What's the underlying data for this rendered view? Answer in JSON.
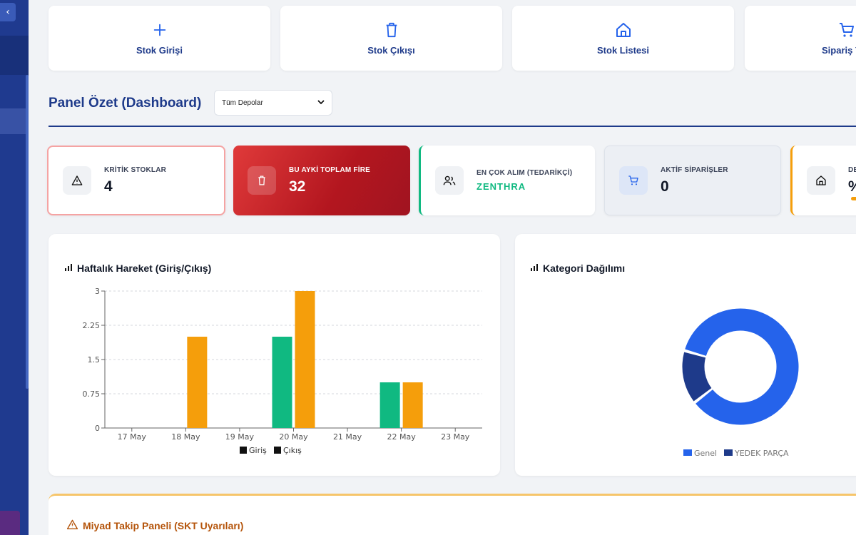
{
  "quick_actions": [
    {
      "label": "Stok Girişi",
      "icon": "plus-icon"
    },
    {
      "label": "Stok Çıkışı",
      "icon": "trash-icon"
    },
    {
      "label": "Stok Listesi",
      "icon": "home-icon"
    },
    {
      "label": "Sipariş Y",
      "icon": "cart-icon"
    }
  ],
  "header": {
    "title": "Panel Özet (Dashboard)",
    "depot_select": "Tüm Depolar"
  },
  "stats": {
    "critical": {
      "label": "KRİTİK STOKLAR",
      "value": "4"
    },
    "fire": {
      "label": "BU AYKİ TOPLAM FİRE",
      "value": "32"
    },
    "supplier": {
      "label": "EN ÇOK ALIM (TEDARİKÇİ)",
      "value": "ZENTHRA"
    },
    "orders": {
      "label": "AKTİF SİPARİŞLER",
      "value": "0"
    },
    "depot": {
      "label": "DE",
      "value": "%"
    }
  },
  "weekly_panel": {
    "title": "Haftalık Hareket (Giriş/Çıkış)"
  },
  "category_panel": {
    "title": "Kategori Dağılımı"
  },
  "bottom_panel": {
    "title": "Miyad Takip Paneli (SKT Uyarıları)"
  },
  "colors": {
    "primary": "#1e3a8a",
    "giris": "#10b981",
    "cikis": "#f59e0b",
    "genel": "#2563eb",
    "yedek": "#1e3a8a"
  },
  "chart_data": [
    {
      "type": "bar",
      "title": "Haftalık Hareket (Giriş/Çıkış)",
      "categories": [
        "17 May",
        "18 May",
        "19 May",
        "20 May",
        "21 May",
        "22 May",
        "23 May"
      ],
      "series": [
        {
          "name": "Giriş",
          "values": [
            0,
            0,
            0,
            2,
            0,
            1,
            0
          ]
        },
        {
          "name": "Çıkış",
          "values": [
            0,
            2,
            0,
            3,
            0,
            1,
            0
          ]
        }
      ],
      "yticks": [
        "0",
        "0.75",
        "1.5",
        "2.25",
        "3"
      ],
      "ylim": [
        0,
        3
      ],
      "grid": true,
      "legend": "bottom"
    },
    {
      "type": "pie",
      "title": "Kategori Dağılımı",
      "labels": [
        "Genel",
        "YEDEK PARÇA"
      ],
      "values": [
        85,
        15
      ],
      "legend": "bottom"
    }
  ]
}
